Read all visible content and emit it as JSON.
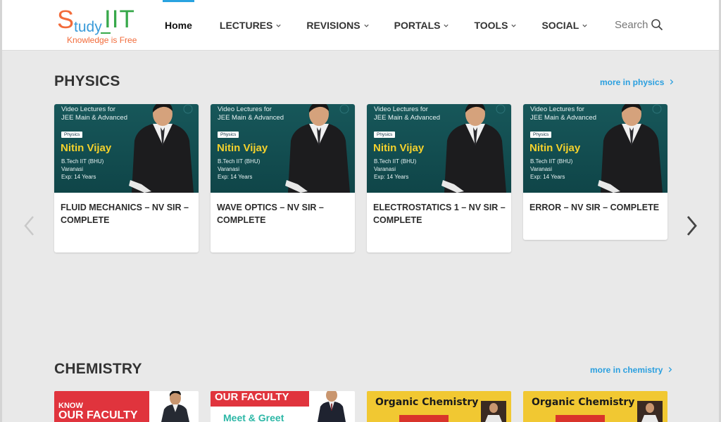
{
  "header": {
    "logo": {
      "s": "S",
      "tudy": "tudy",
      "iit": "IIT",
      "tagline": "Knowledge is Free"
    },
    "nav": [
      {
        "label": "Home",
        "dropdown": false
      },
      {
        "label": "LECTURES",
        "dropdown": true
      },
      {
        "label": "REVISIONS",
        "dropdown": true
      },
      {
        "label": "PORTALS",
        "dropdown": true
      },
      {
        "label": "TOOLS",
        "dropdown": true
      },
      {
        "label": "SOCIAL",
        "dropdown": true
      }
    ],
    "search_label": "Search"
  },
  "physics": {
    "title": "PHYSICS",
    "more": "more in physics",
    "thumb": {
      "line1": "Video Lectures for",
      "line2": "JEE Main & Advanced",
      "badge": "Physics",
      "name": "Nitin Vijay",
      "detail1": "B.Tech IIT (BHU)",
      "detail2": "Varanasi",
      "detail3": "Exp: 14 Years"
    },
    "cards": [
      {
        "title": "FLUID MECHANICS – NV SIR – COMPLETE"
      },
      {
        "title": "WAVE OPTICS – NV SIR – COMPLETE"
      },
      {
        "title": "ELECTROSTATICS 1 – NV SIR – COMPLETE"
      },
      {
        "title": "ERROR – NV SIR – COMPLETE"
      }
    ]
  },
  "chemistry": {
    "title": "CHEMISTRY",
    "more": "more in chemistry",
    "thumbs": {
      "c1_know": "KNOW",
      "c1_faculty": "OUR FACULTY",
      "c2_faculty": "OUR FACULTY",
      "c2_meet": "Meet & Greet",
      "c3_text": "Organic Chemistry",
      "c4_text": "Organic Chemistry"
    }
  },
  "colors": {
    "accent": "#29a3e0",
    "logo_orange": "#f26b3a",
    "logo_blue": "#3a9bd9",
    "logo_green": "#37a84a",
    "thumb_teal": "#17575a",
    "name_yellow": "#f4d12c"
  },
  "icons": {
    "search": "search-icon",
    "chevron": "chevron-down-icon",
    "prev": "chevron-left-icon",
    "next": "chevron-right-icon"
  }
}
